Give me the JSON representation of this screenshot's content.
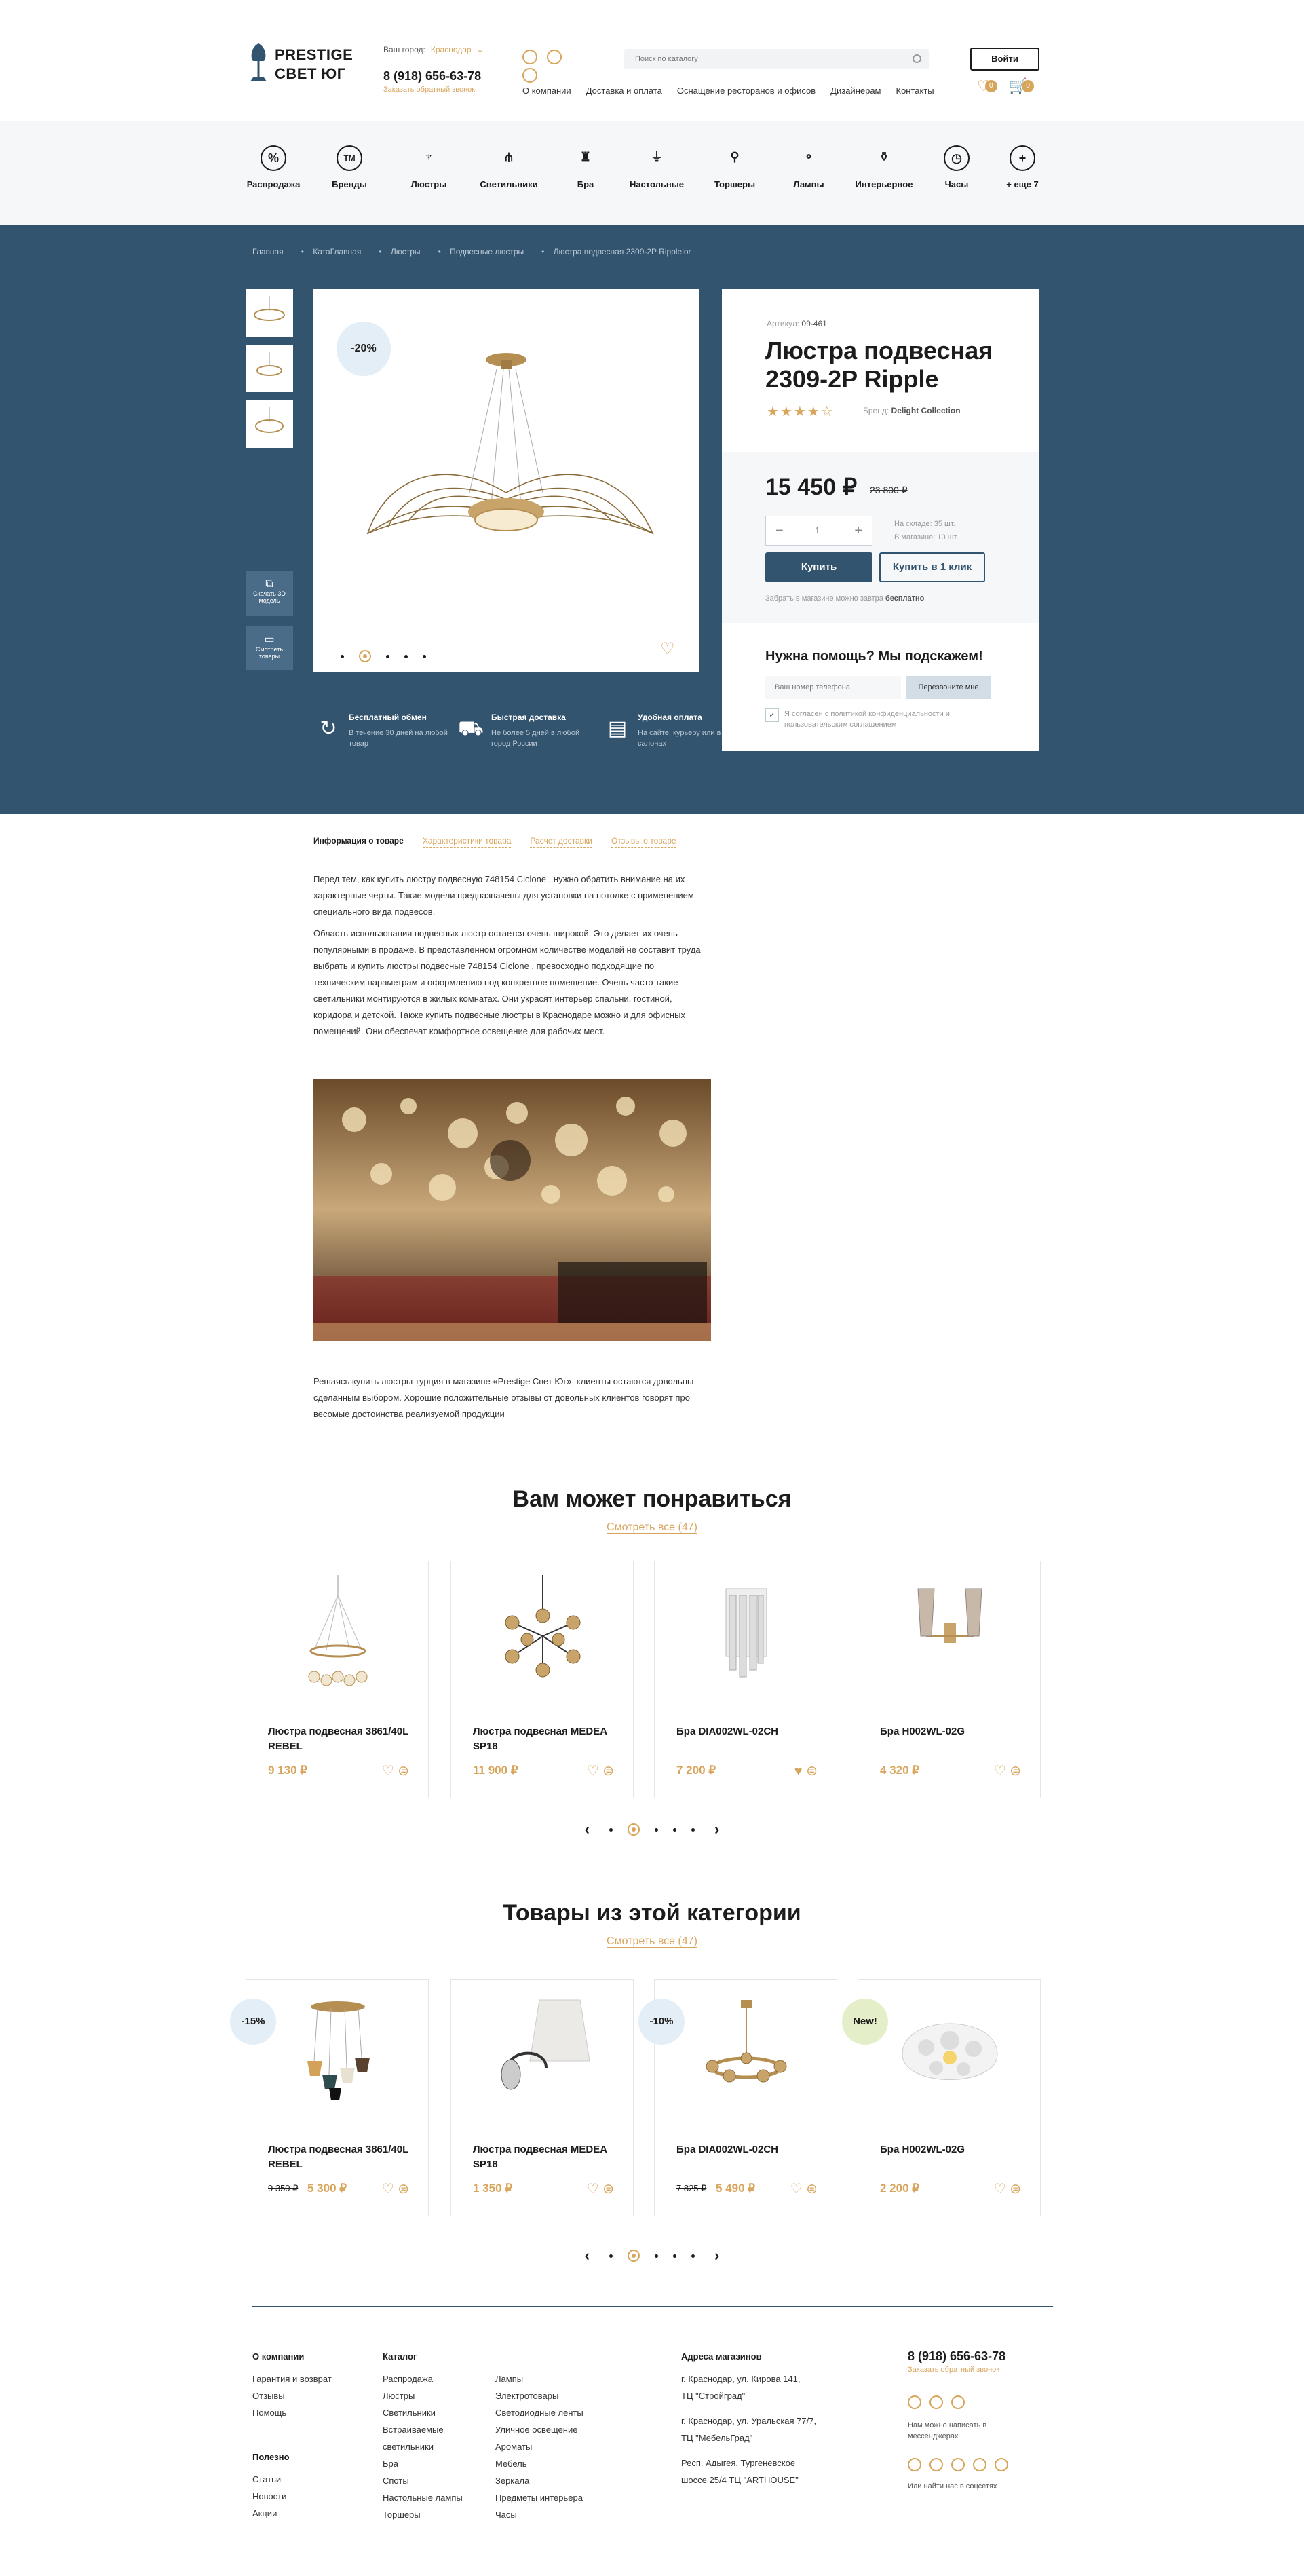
{
  "header": {
    "logo_line1": "PRESTIGE",
    "logo_line2": "СВЕТ ЮГ",
    "city_label": "Ваш город:",
    "city_value": "Краснодар",
    "phone": "8 (918) 656-63-78",
    "callback": "Заказать обратный звонок",
    "search_placeholder": "Поиск по каталогу",
    "nav": [
      "О компании",
      "Доставка и оплата",
      "Оснащение ресторанов и офисов",
      "Дизайнерам",
      "Контакты"
    ],
    "login": "Войти",
    "fav_count": "0",
    "cart_count": "0"
  },
  "categories": [
    {
      "label": "Распродажа",
      "icon": "sale-icon"
    },
    {
      "label": "Бренды",
      "icon": "brand-icon"
    },
    {
      "label": "Люстры",
      "icon": "chandelier-icon"
    },
    {
      "label": "Светильники",
      "icon": "lamps-icon"
    },
    {
      "label": "Бра",
      "icon": "sconce-icon"
    },
    {
      "label": "Настольные",
      "icon": "table-lamp-icon"
    },
    {
      "label": "Торшеры",
      "icon": "floor-lamp-icon"
    },
    {
      "label": "Лампы",
      "icon": "bulb-icon"
    },
    {
      "label": "Интерьерное",
      "icon": "vase-icon"
    },
    {
      "label": "Часы",
      "icon": "clock-icon"
    },
    {
      "label": "+ еще 7",
      "icon": "plus-icon"
    }
  ],
  "breadcrumbs": [
    "Главная",
    "КатаГлавная",
    "Люстры",
    "Подвесные люстры",
    "Люстра подвесная 2309-2P Ripplelor"
  ],
  "gallery": {
    "discount": "-20%",
    "download_3d": "Скачать 3D модель",
    "view_products": "Смотреть товары"
  },
  "features": [
    {
      "title": "Бесплатный обмен",
      "text": "В течение 30 дней на любой товар",
      "icon": "exchange-icon"
    },
    {
      "title": "Быстрая доставка",
      "text": "Не более 5 дней в любой город России",
      "icon": "delivery-icon"
    },
    {
      "title": "Удобная оплата",
      "text": "На сайте, курьеру или в салонах",
      "icon": "payment-icon"
    }
  ],
  "product": {
    "article_label": "Артикул:",
    "article": "09-461",
    "title": "Люстра подвесная 2309-2P Ripple",
    "rating": "4",
    "stars": "★★★★☆",
    "brand_label": "Бренд:",
    "brand": "Delight Collection",
    "price": "15 450 ₽",
    "old_price": "23 800 ₽",
    "qty": "1",
    "stock_warehouse": "На складе: 35 шт.",
    "stock_store": "В магазине: 10 шт.",
    "buy": "Купить",
    "buy_one_click": "Купить в 1 клик",
    "pickup_text": "Забрать в магазине можно завтра",
    "pickup_value": "бесплатно",
    "help_title": "Нужна помощь? Мы подскажем!",
    "phone_placeholder": "Ваш номер телефона",
    "callme": "Перезвоните мне",
    "agree": "Я согласен с политикой конфиденциальности и пользовательским соглашением"
  },
  "tabs": [
    "Информация о товаре",
    "Характеристики товара",
    "Расчет доставки",
    "Отзывы о товаре"
  ],
  "description": {
    "p1": "Перед тем, как купить люстру подвесную 748154 Ciclone , нужно обратить внимание на их характерные черты. Такие модели предназначены для установки на потолке с применением специального вида подвесов.",
    "p2": "Область использования подвесных люстр остается очень широкой. Это делает их очень популярными в продаже. В представленном огромном количестве моделей не составит труда выбрать и купить люстры подвесные 748154 Ciclone , превосходно подходящие по техническим параметрам и оформлению под конкретное помещение. Очень часто такие светильники монтируются в жилых комнатах. Они украсят интерьер спальни, гостиной, коридора и детской. Также купить подвесные люстры в Краснодаре можно и для офисных помещений. Они обеспечат комфортное освещение для рабочих мест.",
    "p3": "Решаясь купить люстры турция в магазине «Prestige Свет Юг», клиенты остаются довольны сделанным выбором. Хорошие положительные отзывы от довольных клиентов говорят про весомые достоинства реализуемой продукции"
  },
  "recommended": {
    "title": "Вам может понравиться",
    "see_all": "Смотреть все",
    "count": "(47)",
    "items": [
      {
        "name": "Люстра подвесная 3861/40L REBEL",
        "price": "9 130 ₽"
      },
      {
        "name": "Люстра подвесная MEDEA SP18",
        "price": "11 900 ₽"
      },
      {
        "name": "Бра DIA002WL-02CH",
        "price": "7 200 ₽"
      },
      {
        "name": "Бра H002WL-02G",
        "price": "4 320 ₽"
      }
    ]
  },
  "category_items": {
    "title": "Товары из этой категории",
    "see_all": "Смотреть все",
    "count": "(47)",
    "items": [
      {
        "badge": "-15%",
        "name": "Люстра подвесная 3861/40L REBEL",
        "old_price": "9 350 ₽",
        "price": "5 300 ₽"
      },
      {
        "badge": "",
        "name": "Люстра подвесная MEDEA SP18",
        "old_price": "",
        "price": "1 350 ₽"
      },
      {
        "badge": "-10%",
        "name": "Бра DIA002WL-02CH",
        "old_price": "7 825 ₽",
        "price": "5 490 ₽"
      },
      {
        "badge": "New!",
        "name": "Бра H002WL-02G",
        "old_price": "",
        "price": "2 200 ₽"
      }
    ]
  },
  "footer": {
    "company_title": "О компании",
    "company_links": [
      "Гарантия и возврат",
      "Отзывы",
      "Помощь"
    ],
    "useful_title": "Полезно",
    "useful_links": [
      "Статьи",
      "Новости",
      "Акции"
    ],
    "catalog_title": "Каталог",
    "catalog_col1": [
      "Распродажа",
      "Люстры",
      "Светильники",
      "Встраиваемые",
      "светильники",
      "Бра",
      "Споты",
      "Настольные лампы",
      "Торшеры"
    ],
    "catalog_col2": [
      "Лампы",
      "Электротовары",
      "Светодиодные ленты",
      "Уличное освещение",
      "Ароматы",
      "Мебель",
      "Зеркала",
      "Предметы интерьера",
      "Часы"
    ],
    "addr_title": "Адреса магазинов",
    "addr1": "г. Краснодар, ул. Кирова 141,",
    "addr1b": "ТЦ \"Стройград\"",
    "addr2": "г. Краснодар, ул. Уральская 77/7,",
    "addr2b": "ТЦ \"МебельГрад\"",
    "addr3": "Респ. Адыгея, Тургеневское",
    "addr3b": "шоссе 25/4 ТЦ \"ARTHOUSE\"",
    "phone": "8 (918) 656-63-78",
    "callback": "Заказать обратный звонок",
    "messengers_text": "Нам можно написать в мессенджерах",
    "social_text": "Или найти нас в соцсетях"
  }
}
